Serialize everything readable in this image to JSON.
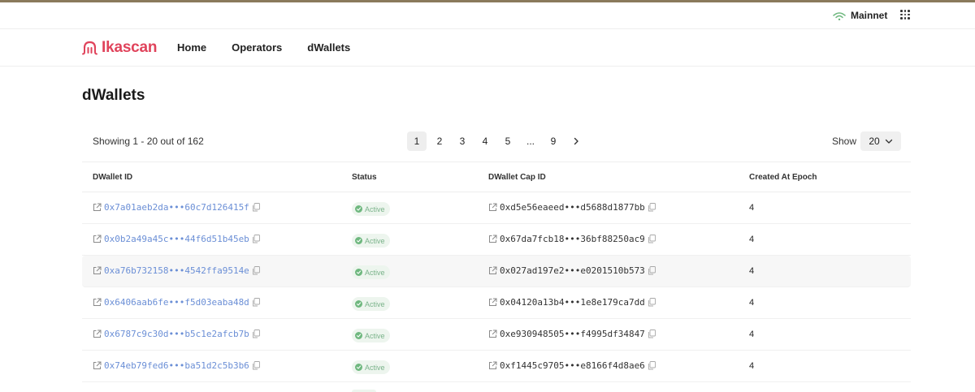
{
  "network": {
    "label": "Mainnet"
  },
  "brand": {
    "name": "Ikascan",
    "color": "#e0435b"
  },
  "nav": {
    "items": [
      {
        "label": "Home"
      },
      {
        "label": "Operators"
      },
      {
        "label": "dWallets"
      }
    ]
  },
  "page": {
    "title": "dWallets"
  },
  "pagination": {
    "showing": "Showing 1 - 20 out of 162",
    "pages": [
      "1",
      "2",
      "3",
      "4",
      "5",
      "...",
      "9"
    ],
    "current": "1",
    "show_label": "Show",
    "page_size": "20"
  },
  "table": {
    "headers": [
      "DWallet ID",
      "Status",
      "DWallet Cap ID",
      "Created At Epoch"
    ],
    "rows": [
      {
        "id": "0x7a01aeb2da•••60c7d126415f",
        "status": "Active",
        "cap": "0xd5e56eaeed•••d5688d1877bb",
        "epoch": "4"
      },
      {
        "id": "0x0b2a49a45c•••44f6d51b45eb",
        "status": "Active",
        "cap": "0x67da7fcb18•••36bf88250ac9",
        "epoch": "4"
      },
      {
        "id": "0xa76b732158•••4542ffa9514e",
        "status": "Active",
        "cap": "0x027ad197e2•••e0201510b573",
        "epoch": "4"
      },
      {
        "id": "0x6406aab6fe•••f5d03eaba48d",
        "status": "Active",
        "cap": "0x04120a13b4•••1e8e179ca7dd",
        "epoch": "4"
      },
      {
        "id": "0x6787c9c30d•••b5c1e2afcb7b",
        "status": "Active",
        "cap": "0xe930948505•••f4995df34847",
        "epoch": "4"
      },
      {
        "id": "0x74eb79fed6•••ba51d2c5b3b6",
        "status": "Active",
        "cap": "0xf1445c9705•••e8166f4d8ae6",
        "epoch": "4"
      }
    ]
  },
  "colors": {
    "link": "#6b8fd6",
    "active_badge_bg": "#edf5ee",
    "active_badge_text": "#7ab38a",
    "network_signal": "#6fb87f"
  }
}
